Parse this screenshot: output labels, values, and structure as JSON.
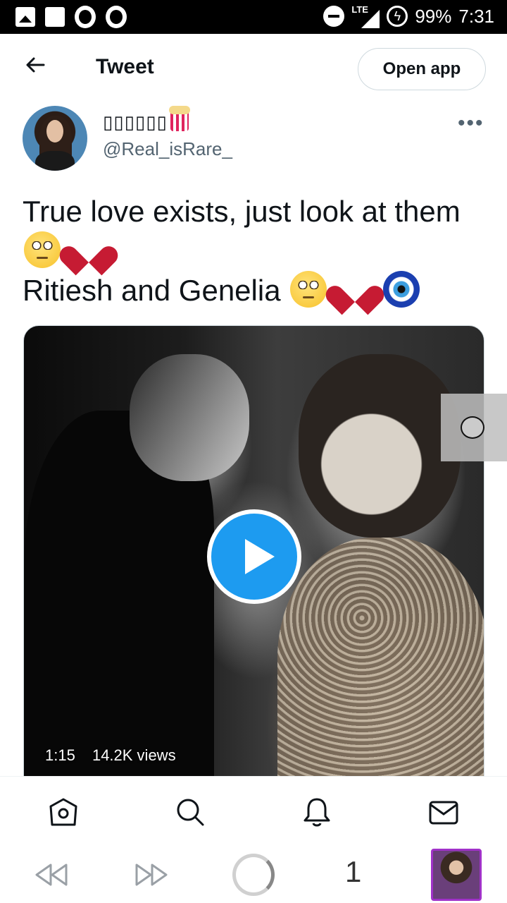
{
  "status_bar": {
    "network": "LTE",
    "battery": "99%",
    "time": "7:31"
  },
  "header": {
    "title": "Tweet",
    "open_app_label": "Open app"
  },
  "author": {
    "display_name": "▯▯▯▯▯▯",
    "handle": "@Real_isRare_"
  },
  "tweet": {
    "line1": "True love exists, just look at them",
    "line2": "Ritiesh and Genelia"
  },
  "media": {
    "duration": "1:15",
    "views": "14.2K views"
  },
  "browser_bar": {
    "tab_count": "1"
  },
  "colors": {
    "accent": "#1d9bf0",
    "text": "#0f1419",
    "secondary": "#536471",
    "heart": "#c61b33"
  }
}
